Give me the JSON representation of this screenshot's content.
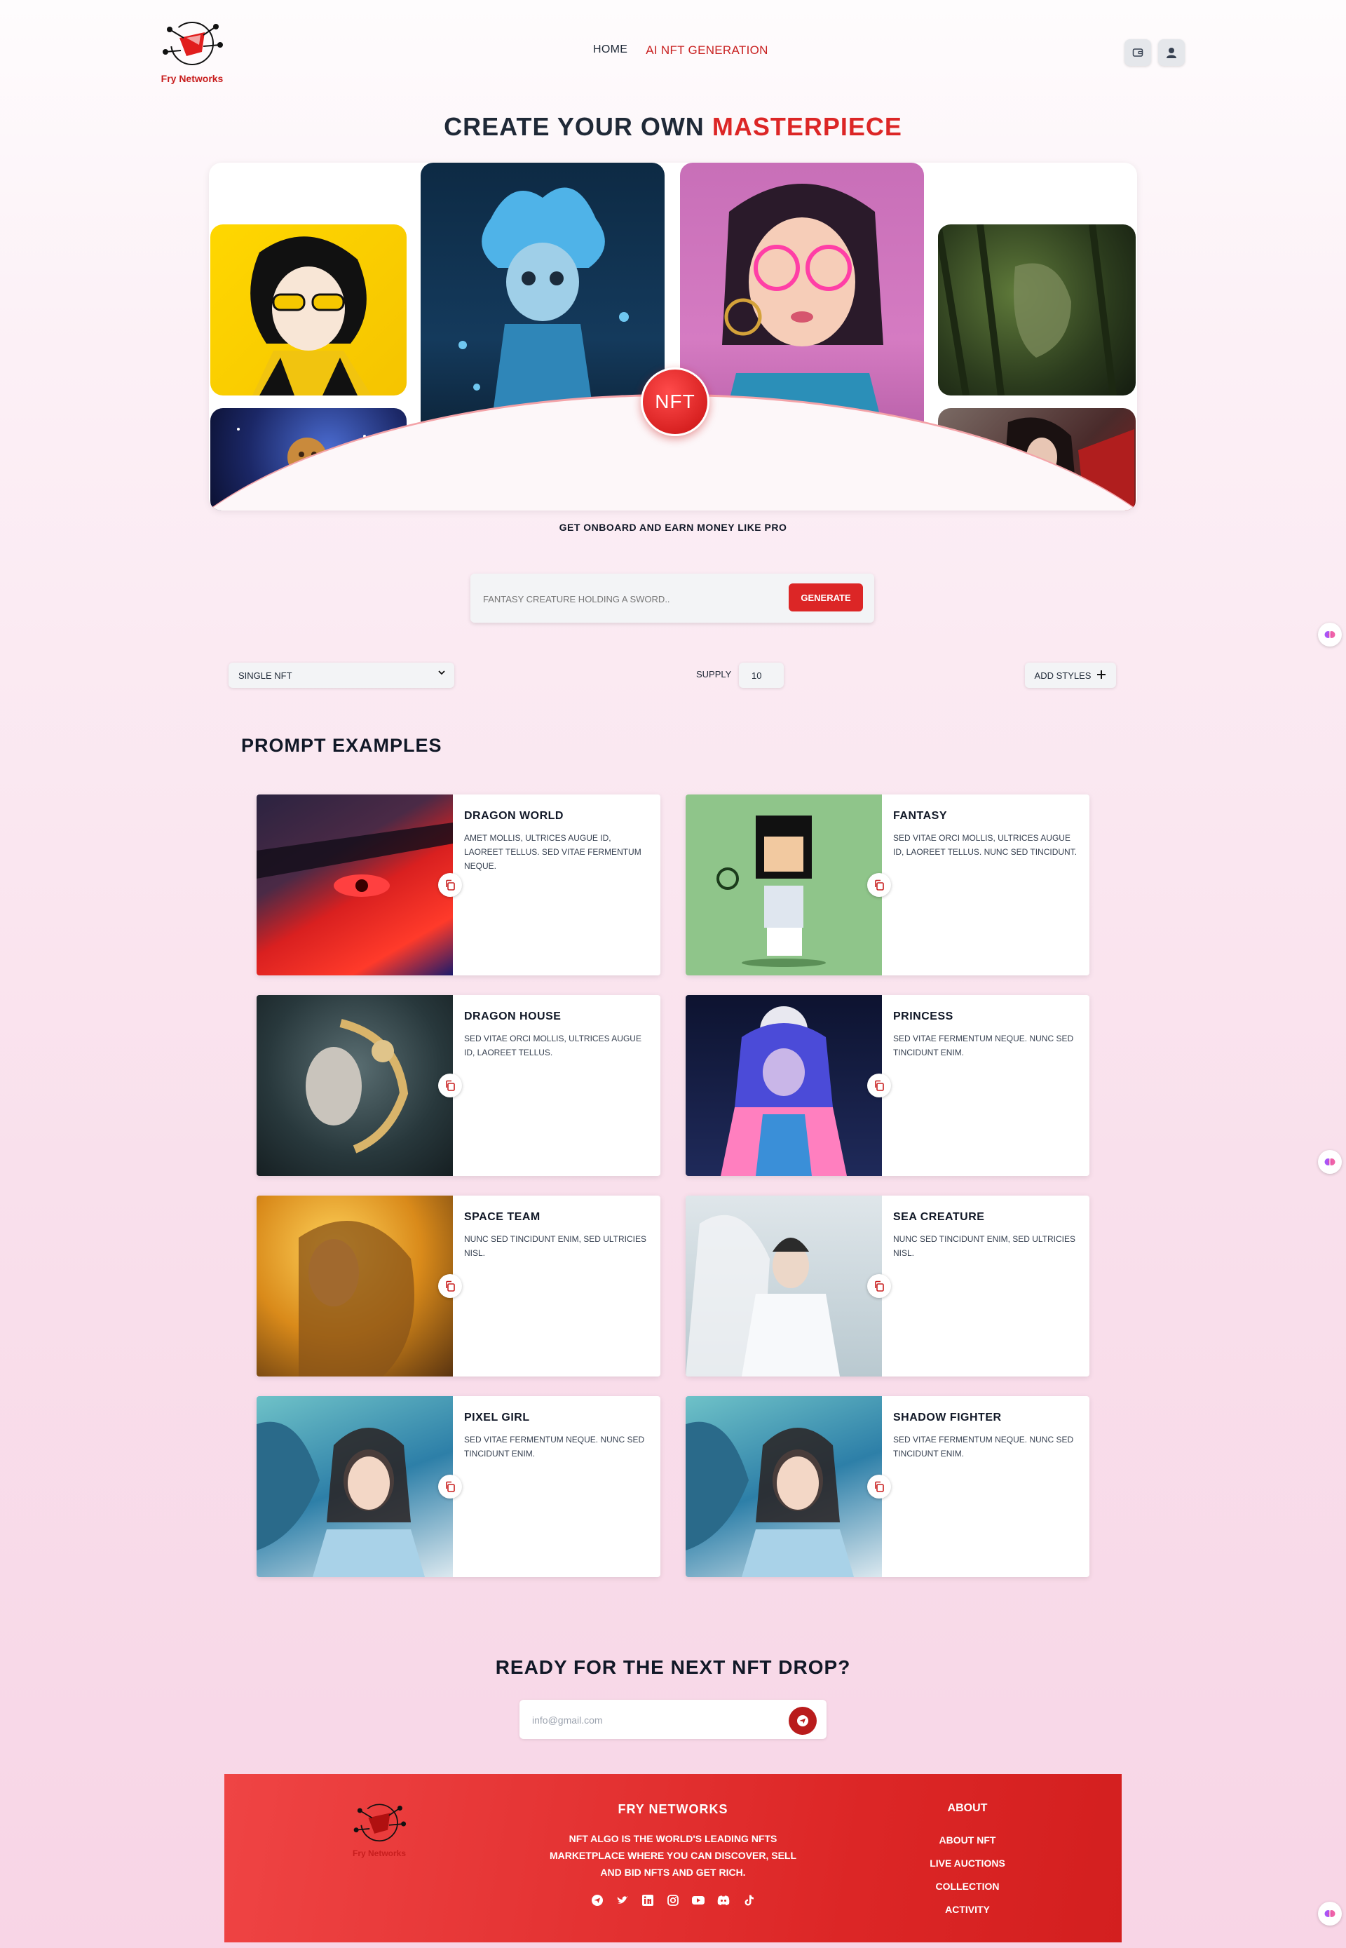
{
  "brand": {
    "name": "Fry Networks"
  },
  "nav": {
    "home": "HOME",
    "ai_nft": "AI NFT GENERATION"
  },
  "header_icons": [
    "wallet-icon",
    "user-icon"
  ],
  "hero": {
    "title_main": "CREATE YOUR OWN",
    "title_accent": "MASTERPIECE",
    "badge": "NFT",
    "tagline": "GET ONBOARD AND EARN MONEY LIKE PRO"
  },
  "generate": {
    "placeholder": "FANTASY CREATURE HOLDING A SWORD..",
    "button": "GENERATE"
  },
  "options": {
    "type_value": "SINGLE NFT",
    "supply_label": "SUPPLY",
    "supply_value": "10",
    "add_styles": "ADD STYLES"
  },
  "prompt_examples": {
    "title": "PROMPT EXAMPLES",
    "cards": [
      {
        "title": "DRAGON WORLD",
        "desc": "AMET MOLLIS, ULTRICES AUGUE ID, LAOREET TELLUS. SED VITAE FERMENTUM NEQUE."
      },
      {
        "title": "FANTASY",
        "desc": "SED VITAE ORCI MOLLIS, ULTRICES AUGUE ID, LAOREET TELLUS. NUNC SED TINCIDUNT."
      },
      {
        "title": "DRAGON HOUSE",
        "desc": "SED VITAE ORCI MOLLIS, ULTRICES AUGUE ID, LAOREET TELLUS."
      },
      {
        "title": "PRINCESS",
        "desc": "SED VITAE FERMENTUM NEQUE. NUNC SED TINCIDUNT ENIM."
      },
      {
        "title": "SPACE TEAM",
        "desc": "NUNC SED TINCIDUNT ENIM, SED ULTRICIES NISL."
      },
      {
        "title": "SEA CREATURE",
        "desc": "NUNC SED TINCIDUNT ENIM, SED ULTRICIES NISL."
      },
      {
        "title": "PIXEL GIRL",
        "desc": "SED VITAE FERMENTUM NEQUE. NUNC SED TINCIDUNT ENIM."
      },
      {
        "title": "SHADOW FIGHTER",
        "desc": "SED VITAE FERMENTUM NEQUE. NUNC SED TINCIDUNT ENIM."
      }
    ]
  },
  "newsletter": {
    "title": "READY FOR THE NEXT NFT DROP?",
    "placeholder": "info@gmail.com"
  },
  "footer": {
    "name": "FRY NETWORKS",
    "desc": "NFT ALGO IS THE WORLD'S LEADING NFTS MARKETPLACE WHERE YOU CAN DISCOVER, SELL AND BID NFTS AND GET RICH.",
    "about_title": "ABOUT",
    "links": [
      "ABOUT NFT",
      "LIVE AUCTIONS",
      "COLLECTION",
      "ACTIVITY"
    ],
    "social": [
      "telegram-icon",
      "twitter-icon",
      "linkedin-icon",
      "instagram-icon",
      "youtube-icon",
      "discord-icon",
      "tiktok-icon"
    ]
  },
  "colors": {
    "accent": "#dc2626",
    "text": "#1f2937"
  }
}
